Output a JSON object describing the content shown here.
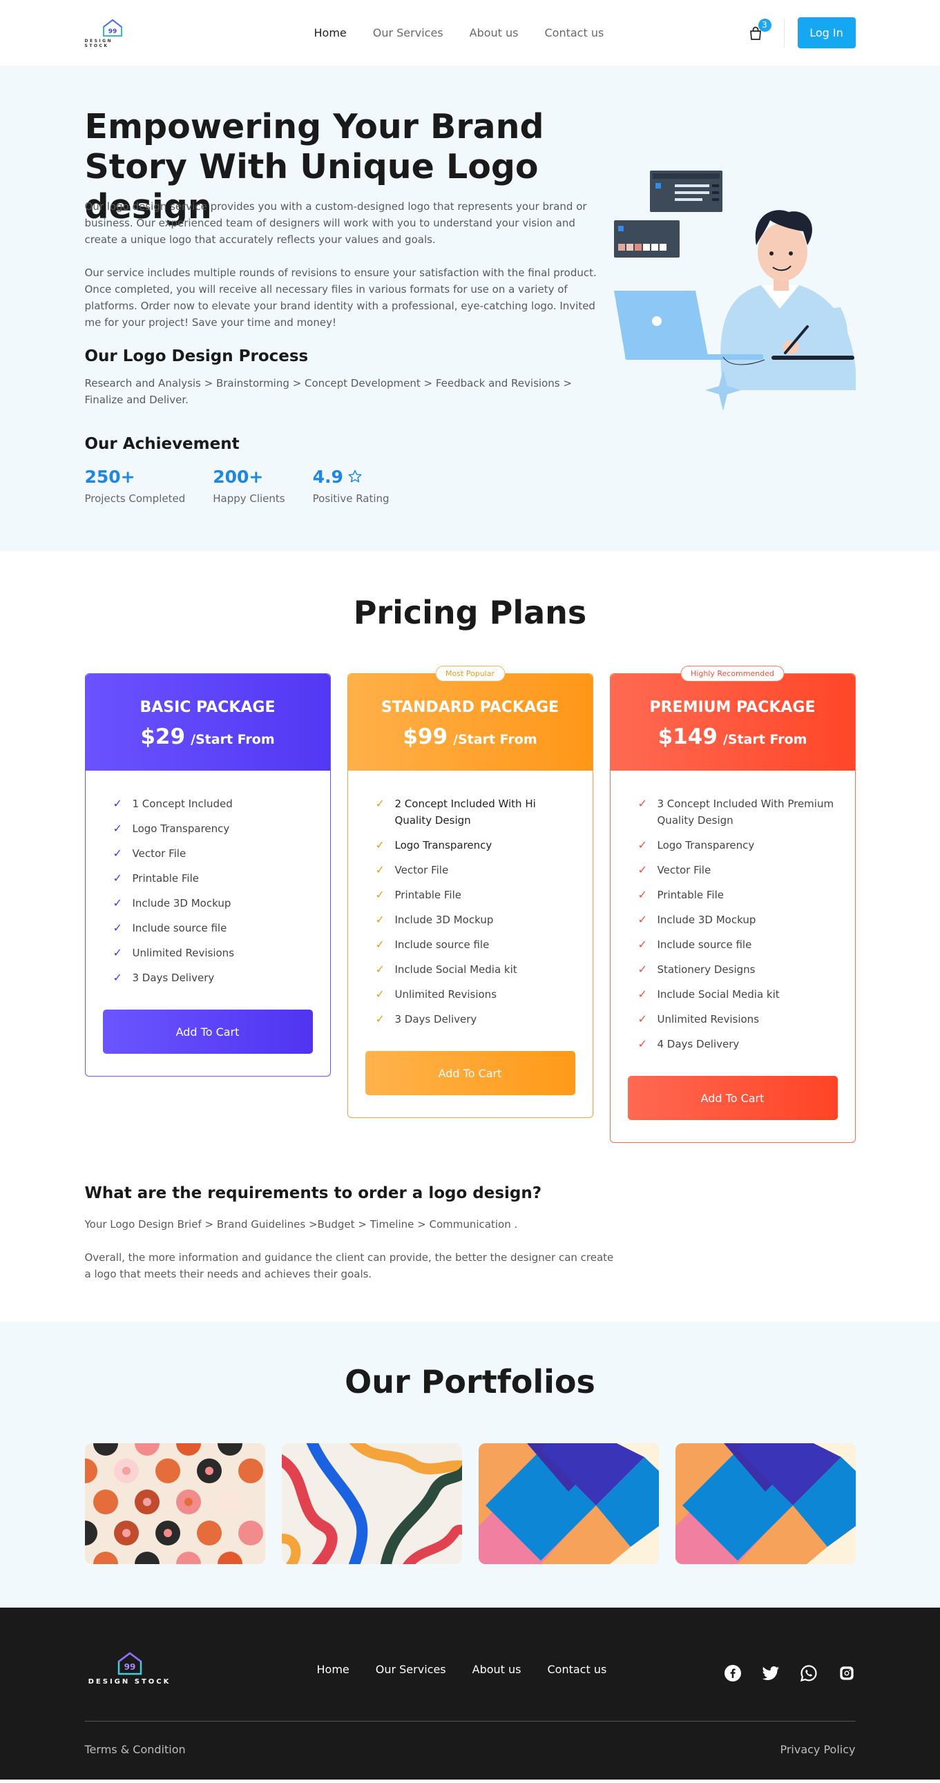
{
  "header": {
    "logo_badge": "99",
    "logo_text": "DESIGN STOCK",
    "nav": [
      "Home",
      "Our Services",
      "About us",
      "Contact us"
    ],
    "cart_count": "3",
    "login_label": "Log In"
  },
  "hero": {
    "title": "Empowering Your Brand Story With Unique Logo design",
    "para1": "Our logo design service provides you with a custom-designed logo that represents your brand or business. Our experienced team of designers will work with you to understand your vision and create a unique logo that accurately reflects your values and goals.",
    "para2": "Our service includes multiple rounds of revisions to ensure your satisfaction with the final product. Once completed, you will receive all necessary files in various formats for use on a variety of platforms. Order now to elevate your brand identity with a professional, eye-catching logo. Invited me for your project! Save your time and money!",
    "process_title": "Our Logo Design Process",
    "process_text": "Research and Analysis > Brainstorming > Concept Development > Feedback and Revisions > Finalize and Deliver.",
    "achievement_title": "Our Achievement",
    "achievements": [
      {
        "value": "250+",
        "label": "Projects Completed"
      },
      {
        "value": "200+",
        "label": "Happy Clients"
      },
      {
        "value": "4.9",
        "label": "Positive Rating"
      }
    ]
  },
  "pricing": {
    "title": "Pricing Plans",
    "plans": [
      {
        "name": "BASIC PACKAGE",
        "price": "$29",
        "per": "/Start From",
        "badge": "",
        "features": [
          "1 Concept Included",
          "Logo Transparency",
          "Vector File",
          "Printable File",
          "Include 3D Mockup",
          "Include source file",
          "Unlimited Revisions",
          "3 Days Delivery"
        ],
        "button": "Add To Cart"
      },
      {
        "name": "STANDARD PACKAGE",
        "price": "$99",
        "per": "/Start From",
        "badge": "Most Popular",
        "features": [
          "2 Concept Included With Hi Quality Design",
          "Logo Transparency",
          "Vector File",
          "Printable File",
          "Include 3D Mockup",
          "Include source file",
          "Include Social Media kit",
          "Unlimited Revisions",
          "3 Days Delivery"
        ],
        "button": "Add To Cart"
      },
      {
        "name": "PREMIUM PACKAGE",
        "price": "$149",
        "per": "/Start From",
        "badge": "Highly Recommended",
        "features": [
          "3 Concept Included With Premium Quality Design",
          "Logo Transparency",
          "Vector File",
          "Printable File",
          "Include 3D Mockup",
          "Include source file",
          "Stationery Designs",
          "Include Social Media kit",
          "Unlimited Revisions",
          "4 Days Delivery"
        ],
        "button": "Add To Cart"
      }
    ],
    "req_title": "What are the requirements to order a logo design?",
    "req_text1": "Your Logo Design Brief > Brand Guidelines >Budget > Timeline > Communication .",
    "req_text2": "Overall, the more information and guidance the client can provide, the better the designer can create a logo that meets their needs and achieves their goals."
  },
  "portfolio": {
    "title": "Our Portfolios"
  },
  "footer": {
    "logo_badge": "99",
    "logo_text": "DESIGN STOCK",
    "nav": [
      "Home",
      "Our Services",
      "About us",
      "Contact us"
    ],
    "social": [
      "facebook-icon",
      "twitter-icon",
      "whatsapp-icon",
      "instagram-icon"
    ],
    "terms": "Terms & Condition",
    "privacy": "Privacy Policy"
  },
  "colors": {
    "accent": "#16a7f3",
    "basic": "#5b42f7",
    "standard": "#ffa22e",
    "premium": "#ff5538",
    "hero_bg": "#f2f9fd",
    "footer_bg": "#1a1a1a"
  }
}
